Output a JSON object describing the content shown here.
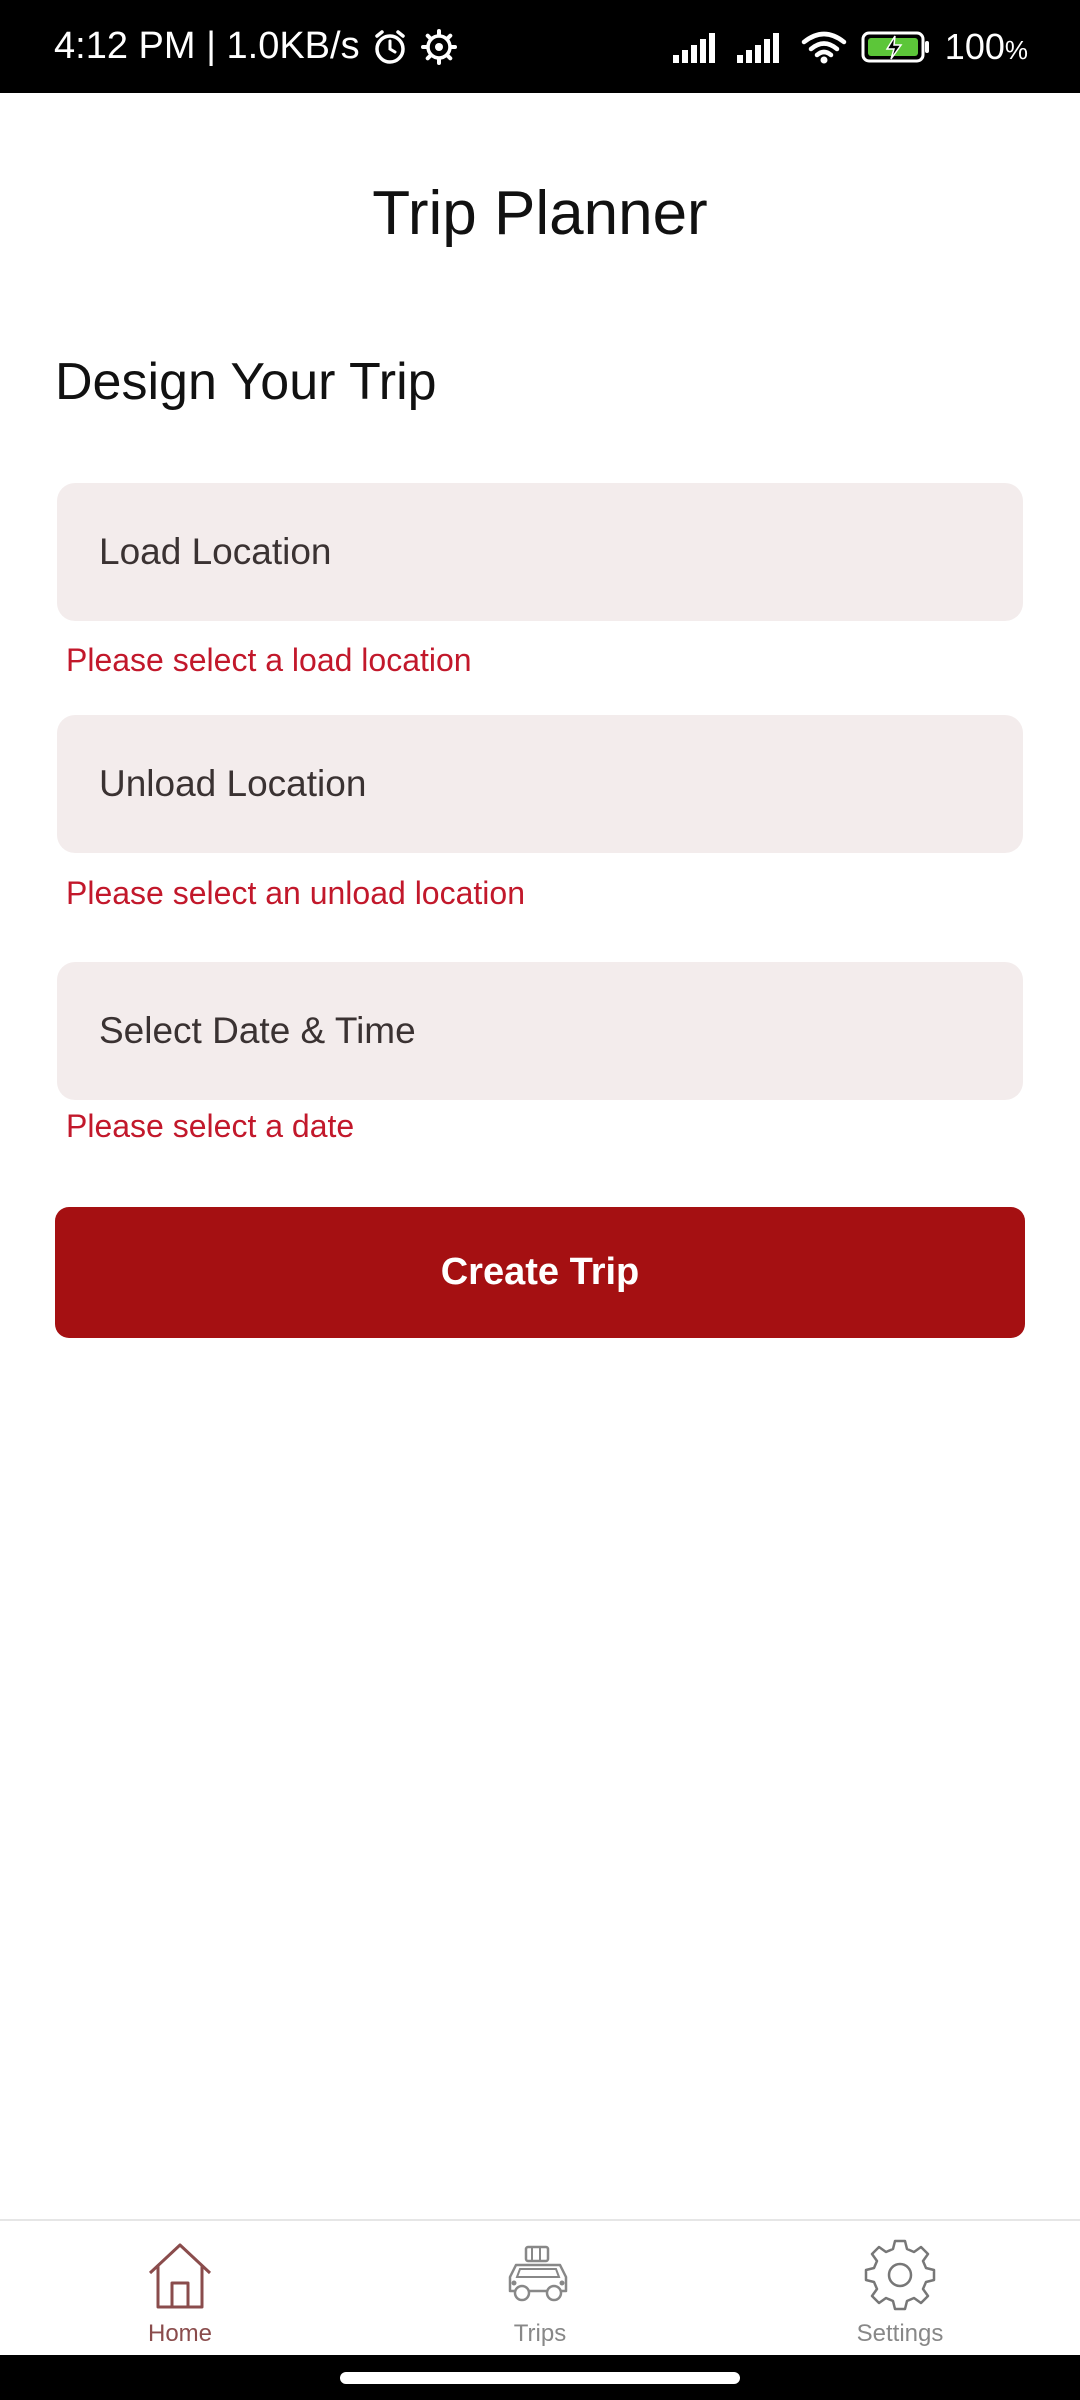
{
  "status_bar": {
    "time_speed": "4:12 PM | 1.0KB/s",
    "battery": "100",
    "battery_unit": "%"
  },
  "header": {
    "title": "Trip Planner"
  },
  "form": {
    "section_title": "Design Your Trip",
    "load_location": {
      "placeholder": "Load Location",
      "error": "Please select a load location"
    },
    "unload_location": {
      "placeholder": "Unload Location",
      "error": "Please select an unload location"
    },
    "date_time": {
      "placeholder": "Select Date & Time",
      "error": "Please select a date"
    },
    "submit_label": "Create Trip"
  },
  "bottom_nav": {
    "items": [
      {
        "label": "Home",
        "icon": "home-icon",
        "active": true
      },
      {
        "label": "Trips",
        "icon": "car-icon",
        "active": false
      },
      {
        "label": "Settings",
        "icon": "gear-icon",
        "active": false
      }
    ]
  },
  "colors": {
    "accent": "#a51012",
    "error": "#c2182b",
    "field_bg": "#f3ecec"
  }
}
